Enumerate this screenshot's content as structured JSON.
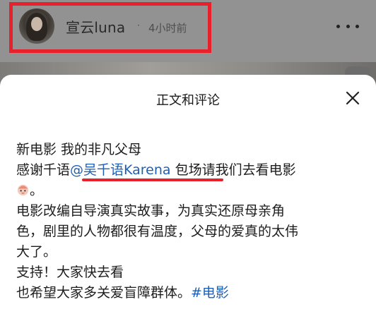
{
  "post": {
    "author": "宣云luna",
    "separator": "·",
    "time": "4小时前"
  },
  "sheet": {
    "title": "正文和评论"
  },
  "content": {
    "line1": "新电影 我的非凡父母",
    "line2_prefix": "感谢千语",
    "mention": "@吴千语Karena",
    "line2_suffix": " 包场请我们去看电影",
    "line3_suffix": "。",
    "line4": "电影改编自导演真实故事，为真实还原母亲角",
    "line5": "色，剧里的人物都很有温度，父母的爱真的太伟",
    "line6": "大了。",
    "line7": "支持！大家快去看",
    "line8_prefix": "也希望大家多关爱盲障群体。",
    "hashtag": "#电影"
  },
  "colors": {
    "highlight_red": "#e8202c",
    "link_blue": "#1d5fb5"
  },
  "icons": {
    "more": "more-dots-icon",
    "close": "close-icon",
    "emoji": "cute-face-emoji-icon"
  }
}
